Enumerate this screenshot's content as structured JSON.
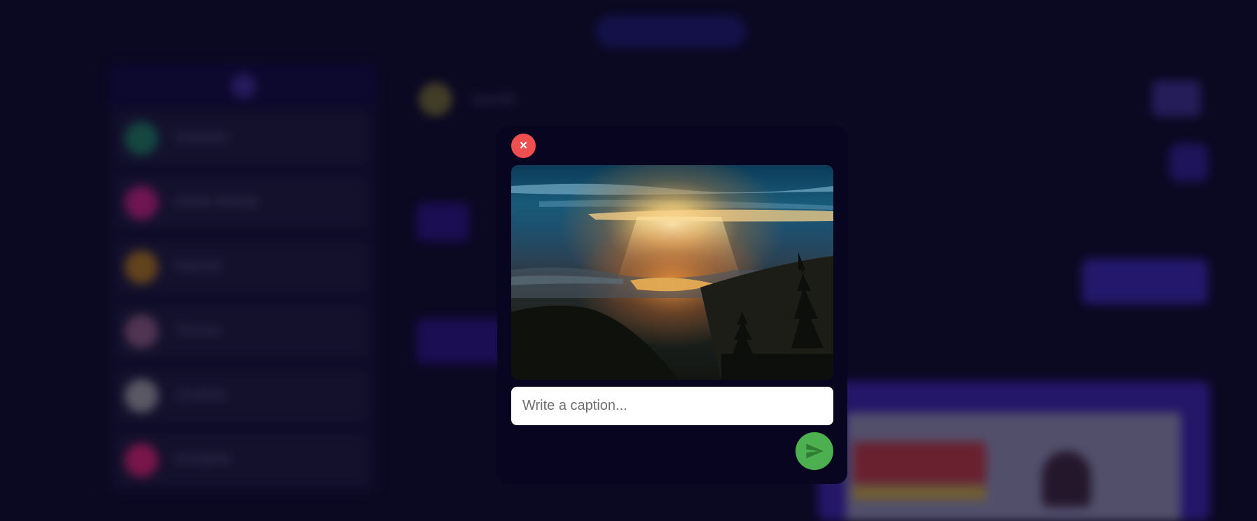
{
  "background": {
    "header": {
      "title": "Sam99"
    },
    "chats": [
      {
        "name": "Andrades",
        "color": "#1e7a5a"
      },
      {
        "name": "Ashish Mehata",
        "color": "#c0207a"
      },
      {
        "name": "Ramesh",
        "color": "#a8741a"
      },
      {
        "name": "Thomas",
        "color": "#8a5a7a"
      },
      {
        "name": "Jonathan",
        "color": "#9a9a9a"
      },
      {
        "name": "Annabelle",
        "color": "#d4226a"
      }
    ]
  },
  "modal": {
    "close_label": "×",
    "image_alt": "sunset-over-mountains",
    "caption": {
      "placeholder": "Write a caption...",
      "value": ""
    },
    "send_icon": "send-icon"
  },
  "colors": {
    "close_button": "#f04f4f",
    "send_button": "#4caf50",
    "modal_bg": "#080521",
    "page_bg": "#0b0822"
  }
}
